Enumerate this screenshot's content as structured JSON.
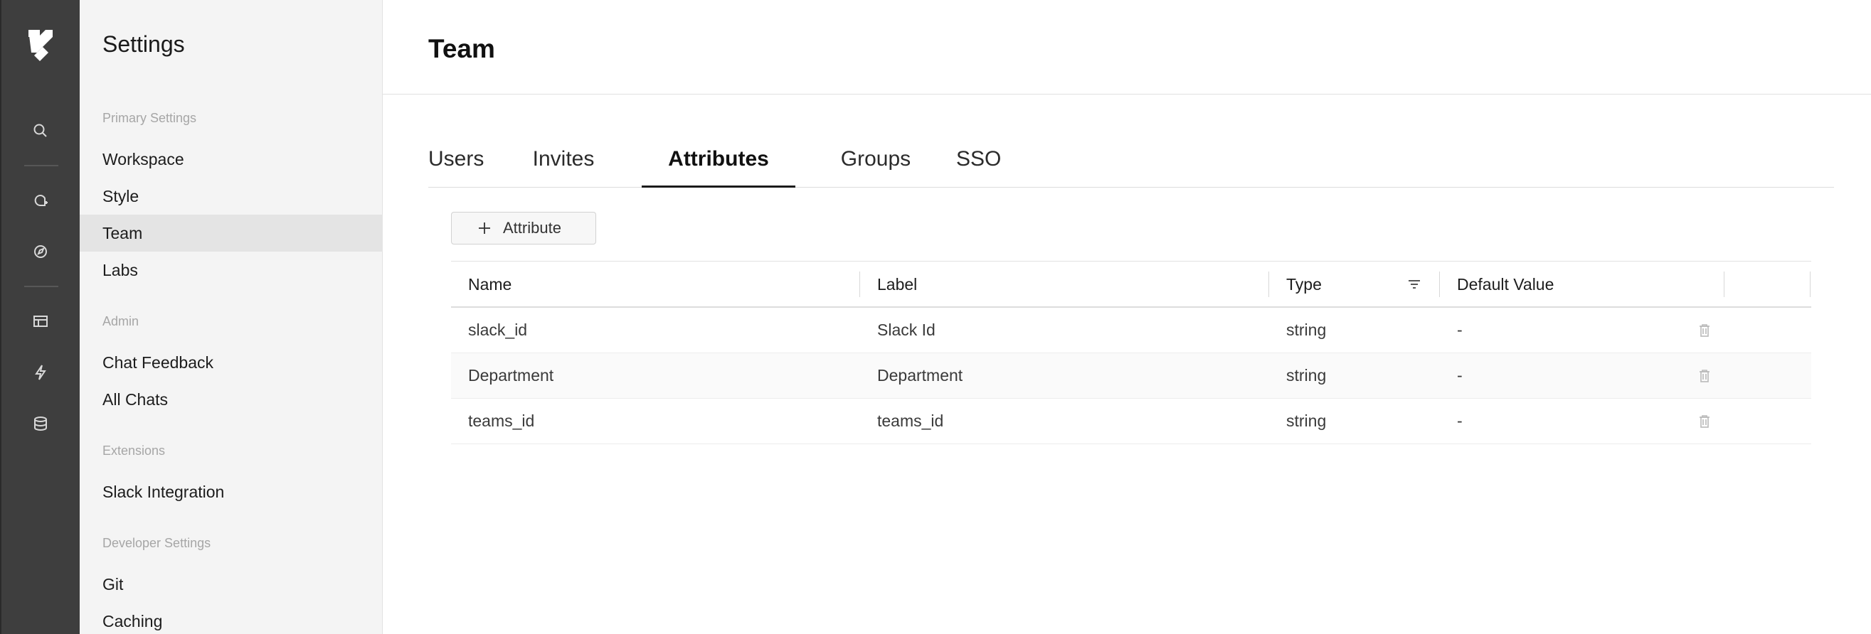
{
  "rail": {
    "logo": "retool-logo",
    "icons": [
      "search-icon",
      "notification-icon",
      "explore-icon",
      "table-icon",
      "lightning-icon",
      "database-icon"
    ]
  },
  "sidebar": {
    "title": "Settings",
    "groups": [
      {
        "label": "Primary Settings",
        "items": [
          "Workspace",
          "Style",
          "Team",
          "Labs"
        ]
      },
      {
        "label": "Admin",
        "items": [
          "Chat Feedback",
          "All Chats"
        ]
      },
      {
        "label": "Extensions",
        "items": [
          "Slack Integration"
        ]
      },
      {
        "label": "Developer Settings",
        "items": [
          "Git",
          "Caching"
        ]
      }
    ],
    "active_item": "Team"
  },
  "main": {
    "title": "Team",
    "tabs": [
      "Users",
      "Invites",
      "Attributes",
      "Groups",
      "SSO"
    ],
    "active_tab": "Attributes",
    "add_button_label": "Attribute",
    "table": {
      "columns": [
        "Name",
        "Label",
        "Type",
        "Default Value"
      ],
      "rows": [
        {
          "name": "slack_id",
          "label": "Slack Id",
          "type": "string",
          "default": "-"
        },
        {
          "name": "Department",
          "label": "Department",
          "type": "string",
          "default": "-"
        },
        {
          "name": "teams_id",
          "label": "teams_id",
          "type": "string",
          "default": "-"
        }
      ]
    }
  },
  "colors": {
    "rail_bg": "#3e3e3e",
    "sidebar_bg": "#f4f4f4",
    "active_item_bg": "#e4e4e4",
    "accent": "#1a1a1a"
  }
}
